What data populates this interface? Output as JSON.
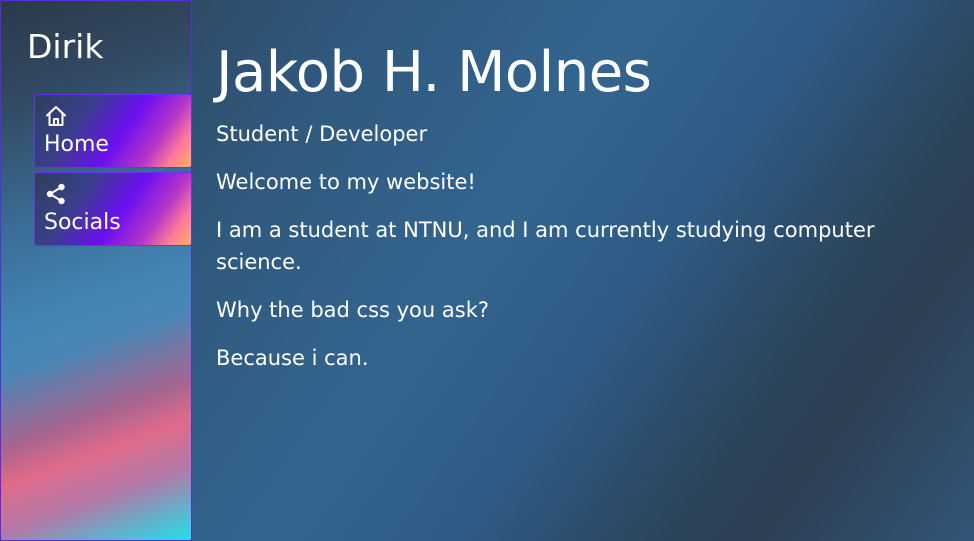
{
  "sidebar": {
    "brand": "Dirik",
    "items": [
      {
        "icon": "home-icon",
        "label": "Home"
      },
      {
        "icon": "share-icon",
        "label": "Socials"
      }
    ]
  },
  "main": {
    "title": "Jakob H. Molnes",
    "subtitle": "Student / Developer",
    "paragraphs": [
      "Welcome to my website!",
      "I am a student at NTNU, and I am currently studying computer science.",
      "Why the bad css you ask?",
      "Because i can."
    ]
  }
}
